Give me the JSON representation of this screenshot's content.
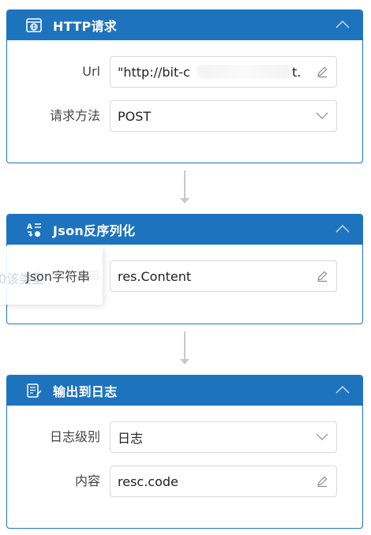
{
  "nodes": [
    {
      "title": "HTTP请求",
      "icon": "globe-window-icon",
      "fields": [
        {
          "label": "Url",
          "value": "\"http://bit-c",
          "trailing_value": "t.",
          "icon": "edit-icon"
        },
        {
          "label": "请求方法",
          "value": "POST",
          "icon": "chevron-down-icon"
        }
      ]
    },
    {
      "title": "Json反序列化",
      "icon": "transform-icon",
      "ghost_text": "0该类型",
      "fields": [
        {
          "label": "Json字符串",
          "value": "res.Content",
          "icon": "edit-icon"
        }
      ]
    },
    {
      "title": "输出到日志",
      "icon": "log-icon",
      "fields": [
        {
          "label": "日志级别",
          "value": "日志",
          "icon": "chevron-down-icon"
        },
        {
          "label": "内容",
          "value": "resc.code",
          "icon": "edit-icon"
        }
      ]
    }
  ],
  "colors": {
    "header": "#1e73be",
    "border": "#1f74c4",
    "connector": "#c9c9c9"
  }
}
